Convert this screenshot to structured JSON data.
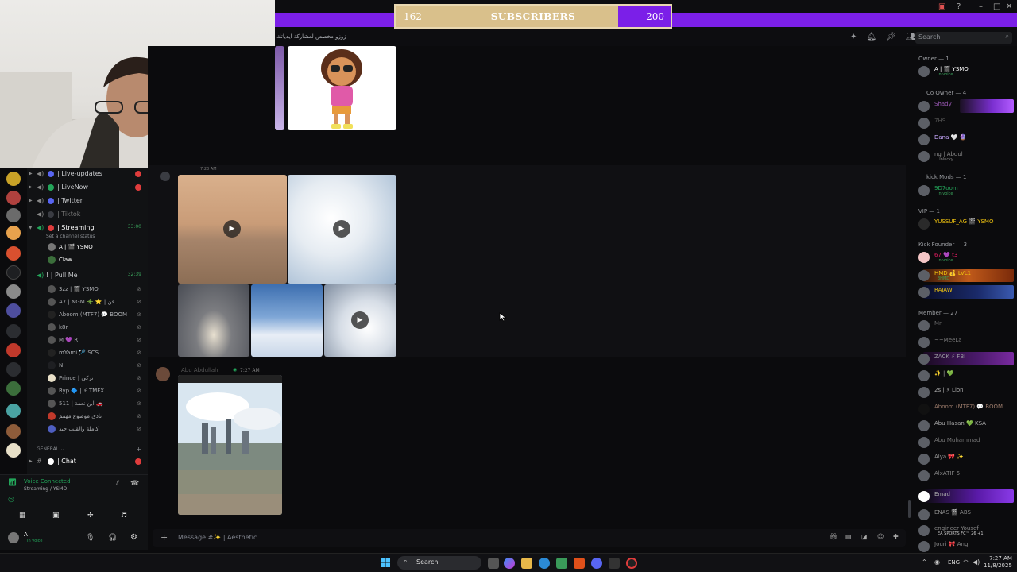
{
  "subscriber_goal": {
    "current": "162",
    "label": "SUBSCRIBERS",
    "target": "200",
    "progress": 0.81
  },
  "top": {
    "channel_topic": "زوزو مخصص لمشاركة ايدياتك",
    "search_placeholder": "Search"
  },
  "channels": [
    {
      "name": "| Live-updates",
      "dot": "#5865f2",
      "badge": true
    },
    {
      "name": "| LiveNow",
      "dot": "#23a55a",
      "badge": true
    },
    {
      "name": "| Twitter",
      "dot": "#5865f2",
      "badge": false
    },
    {
      "name": "| Tiktok",
      "dot": "#2b2d31",
      "badge": false
    }
  ],
  "streaming": {
    "name": "| Streaming",
    "time": "33:00",
    "status": "Set a channel status",
    "users": [
      {
        "name": "A | 🎬 YSMO"
      },
      {
        "name": "Claw"
      }
    ]
  },
  "pull_me": {
    "name": "! | Pull Me",
    "time": "32:39",
    "users": [
      {
        "name": "3zz | 🎬 YSMO"
      },
      {
        "name": "A7 | NGM ✳️ ⭐ | فن"
      },
      {
        "name": "Aboom (MTF7) 💬 BOOM"
      },
      {
        "name": "k8r"
      },
      {
        "name": "M 💜 RT"
      },
      {
        "name": "mYami 🏸 SCS"
      },
      {
        "name": "N"
      },
      {
        "name": "Prince | تركي"
      },
      {
        "name": "Ryp 🔷 | ⚡ TMFX"
      },
      {
        "name": "511 | ابن نعمة 🚗"
      },
      {
        "name": "نادي موضوع مهمم"
      },
      {
        "name": "كاملة والقلب جيد"
      }
    ]
  },
  "general": {
    "label": "GENERAL",
    "chat": "| Chat"
  },
  "voice_panel": {
    "status": "Voice Connected",
    "sub": "Streaming / YSMO",
    "user": "A",
    "user_status": "In voice"
  },
  "messages": {
    "sender": "Abu Abdullah",
    "sender_time": "7:27 AM",
    "prev_time": "7:23 AM"
  },
  "composer": {
    "placeholder": "Message #✨ | Aesthetic"
  },
  "members": {
    "groups": [
      {
        "label": "Owner — 1"
      },
      {
        "label": "Co Owner — 4"
      },
      {
        "label": "kick Mods — 1"
      },
      {
        "label": "VIP — 1"
      },
      {
        "label": "Kick Founder — 3"
      },
      {
        "label": "Member — 27"
      }
    ],
    "owner": [
      {
        "name": "A | 🎬 YSMO",
        "status": "In voice",
        "color": "#ffffff"
      }
    ],
    "co_owner": [
      {
        "name": "Shady",
        "color": "#9b59b6"
      },
      {
        "name": "7HS",
        "color": "#555555"
      },
      {
        "name": "Dana 🤍 🔮",
        "color": "#c9a9ff"
      },
      {
        "name": "ng | Abdul",
        "status": "Unlucky",
        "color": "#888888"
      }
    ],
    "kick_mods": [
      {
        "name": "9D7oom",
        "status": "In voice",
        "color": "#23a55a"
      }
    ],
    "vip": [
      {
        "name": "YUSSUF_AG 🎬 YSMO",
        "color": "#f1c40f"
      }
    ],
    "kick_founder": [
      {
        "name": "67 💜 t3",
        "status": "In voice",
        "color": "#e91e63"
      },
      {
        "name": "HMD 💰 LVL1",
        "status": "3HMD",
        "color": "#f1c40f"
      },
      {
        "name": "RAJAWI",
        "color": "#f1c40f"
      }
    ],
    "member": [
      {
        "name": "Mr",
        "color": "#666666"
      },
      {
        "name": "~~MeeLa",
        "color": "#777777"
      },
      {
        "name": "ZACK ⚡ FBI",
        "color": "#7d7d7d"
      },
      {
        "name": "✨ | 💚",
        "color": "#aaaaaa"
      },
      {
        "name": "2s | ⚡ Lion",
        "color": "#aaaaaa"
      },
      {
        "name": "Aboom (MTF7) 💬 BOOM",
        "color": "#9a7a6a"
      },
      {
        "name": "Abu Hasan 💚 KSA",
        "color": "#aaaaaa"
      },
      {
        "name": "Abu Muhammad",
        "color": "#777777"
      },
      {
        "name": "Alya 🎀 ✨",
        "color": "#999999"
      },
      {
        "name": "AlxATIF 5!",
        "color": "#888888"
      },
      {
        "name": "Emad",
        "color": "#aaaaaa"
      },
      {
        "name": "ENAS 🎬 ABS",
        "color": "#888888"
      },
      {
        "name": "engineer Yousef",
        "status": "EA SPORTS FC™ 26 +1",
        "color": "#888888"
      },
      {
        "name": "Jouri 🎀 Angl",
        "color": "#888888"
      }
    ]
  },
  "taskbar": {
    "search": "Search",
    "lang": "ENG",
    "time": "7:27 AM",
    "date": "11/8/2025"
  },
  "icons": [
    "play-icon",
    "search-icon",
    "speaker-icon",
    "mic-icon",
    "headphones-icon",
    "gear-icon",
    "bell-icon",
    "pin-icon",
    "members-icon",
    "plus-icon",
    "gift-icon",
    "gif-icon",
    "sticker-icon",
    "emoji-icon",
    "apps-icon",
    "windows-icon"
  ],
  "colors": {
    "accent": "#7b1fe8",
    "goal_fill": "#d9c08b",
    "online": "#23a55a",
    "badge": "#e03c3c"
  }
}
